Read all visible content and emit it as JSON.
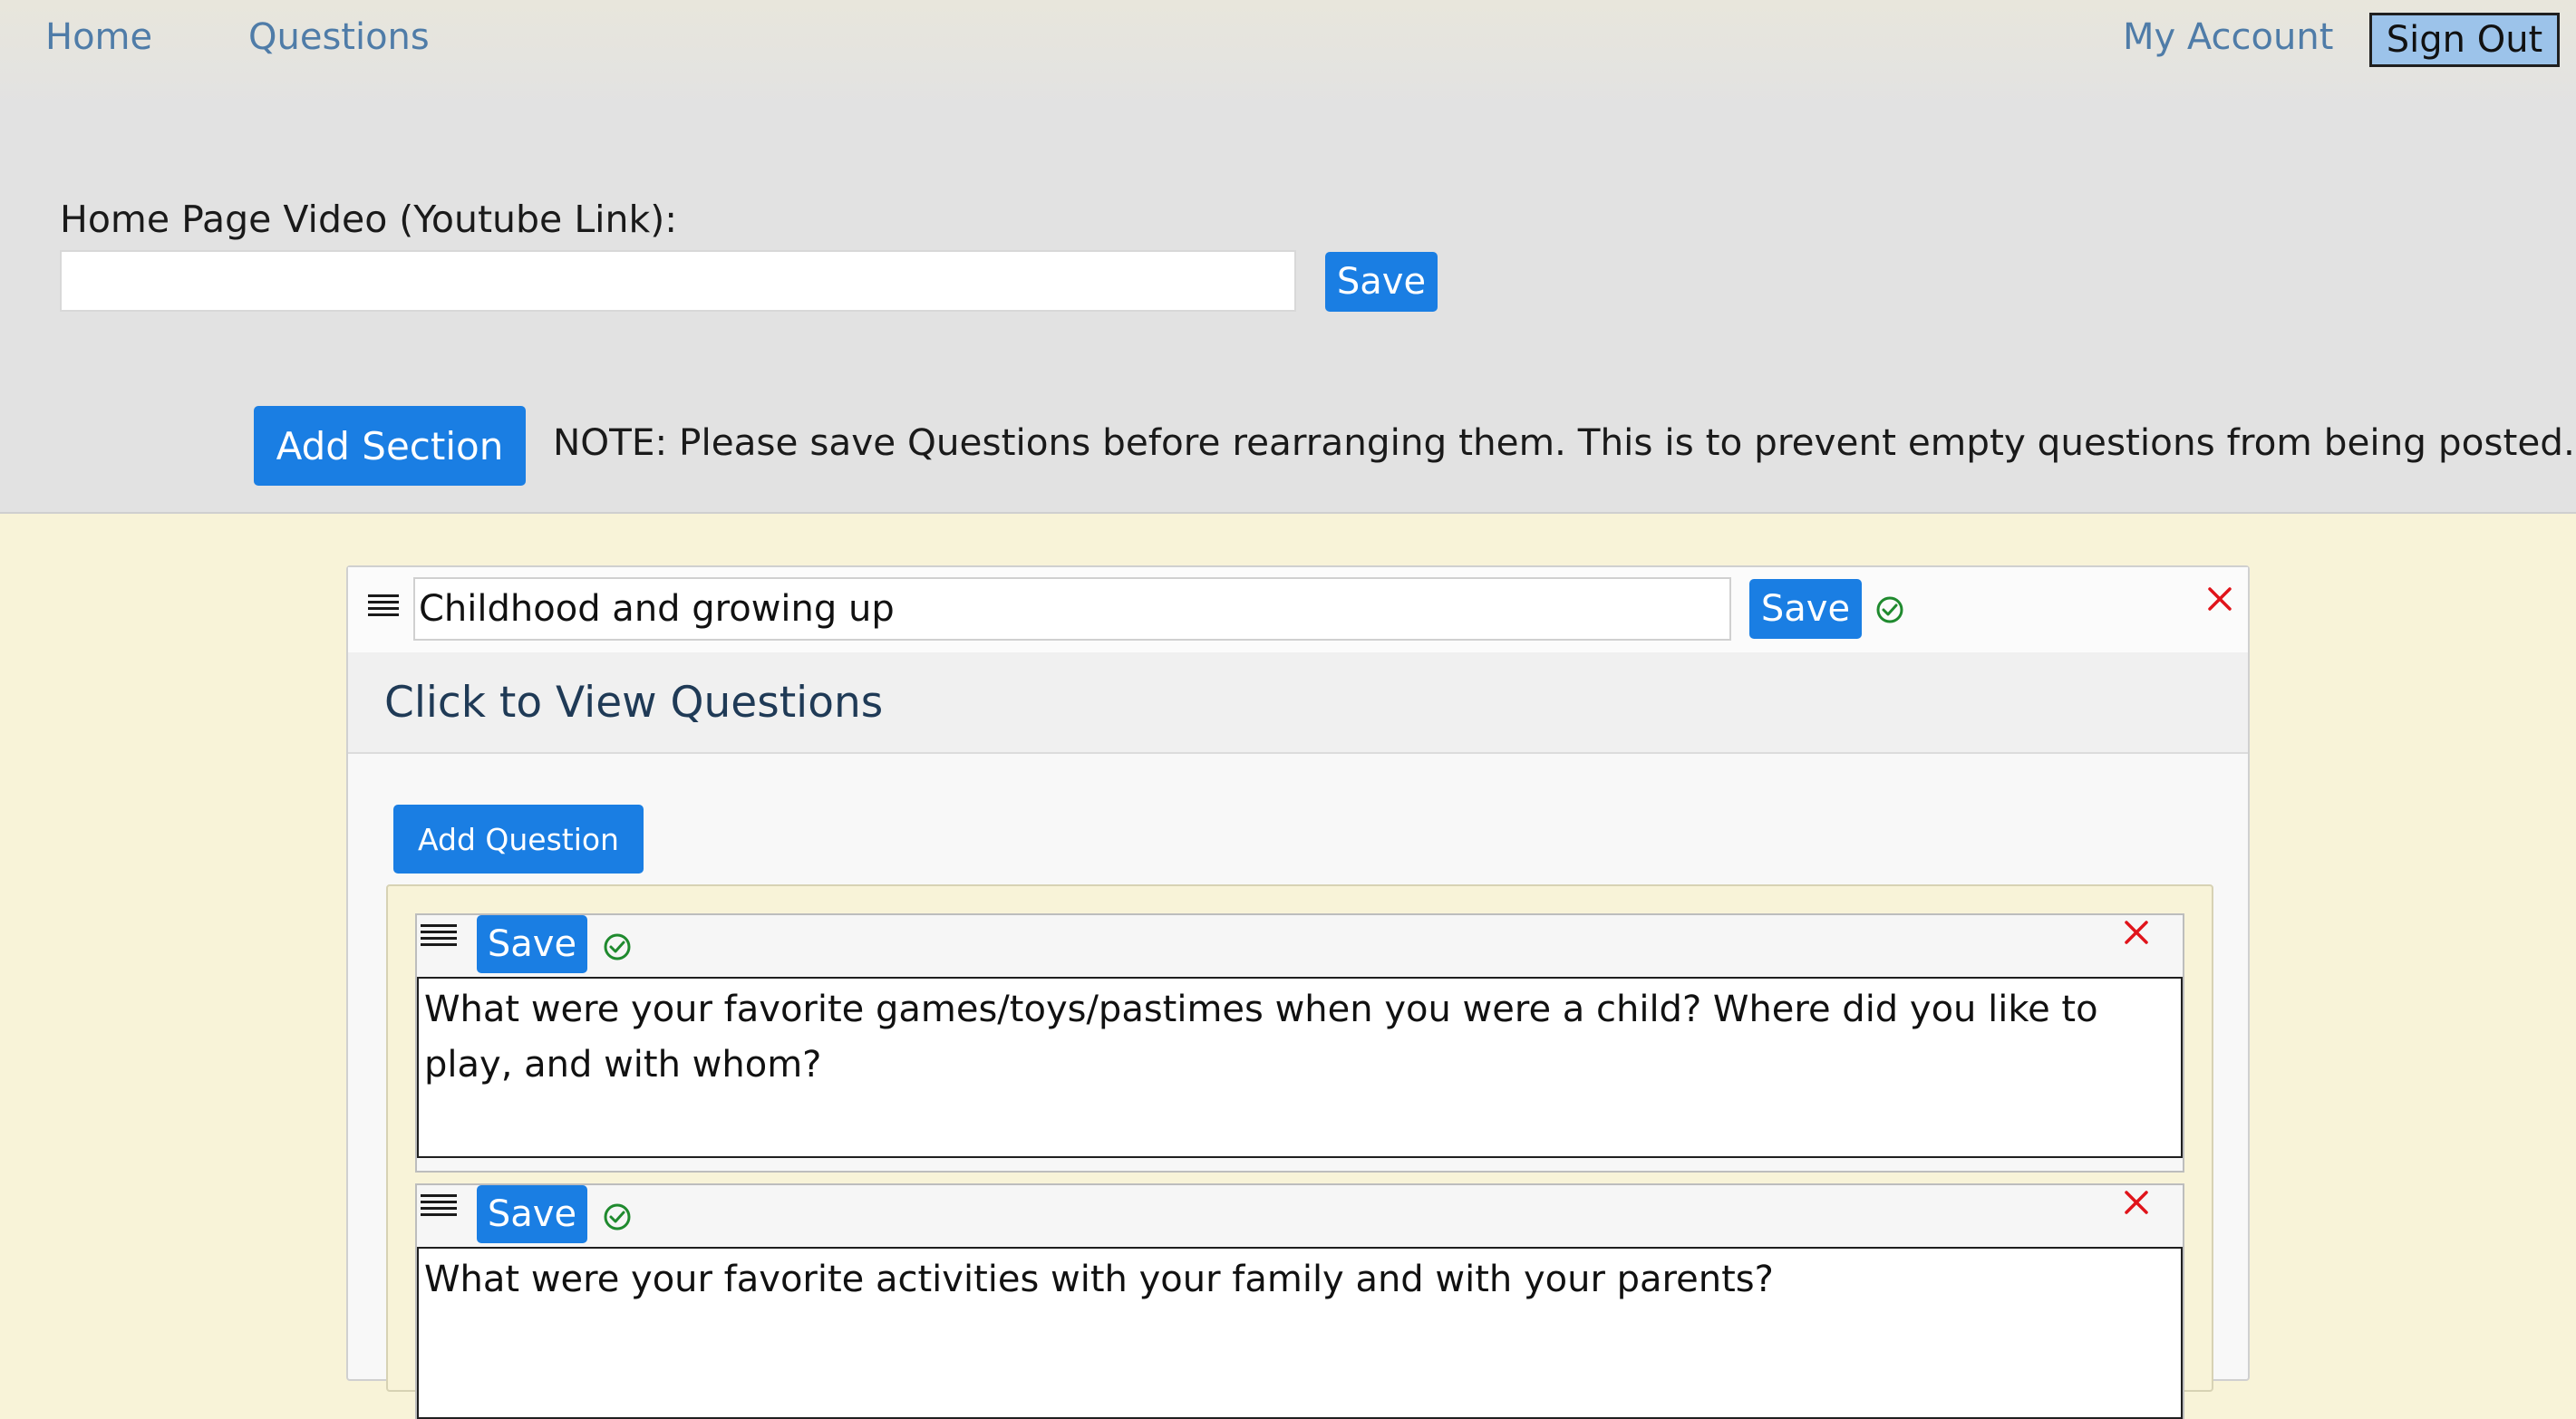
{
  "nav": {
    "home": "Home",
    "questions": "Questions",
    "my_account": "My Account",
    "sign_out": "Sign Out"
  },
  "video": {
    "label": "Home Page Video (Youtube Link):",
    "value": "",
    "placeholder": "",
    "save_label": "Save"
  },
  "actions": {
    "add_section": "Add Section",
    "note": "NOTE: Please save Questions before rearranging them. This is to prevent empty questions from being posted."
  },
  "section": {
    "title": "Childhood and growing up",
    "save_label": "Save",
    "view_questions": "Click to View Questions",
    "add_question": "Add Question",
    "questions": [
      {
        "save_label": "Save",
        "text": "What were your favorite games/toys/pastimes when you were a child? Where did you like to play, and with whom?"
      },
      {
        "save_label": "Save",
        "text": "What were your favorite activities with your family and with your parents?"
      }
    ]
  },
  "colors": {
    "accent": "#1a7ee3",
    "nav_link": "#4f7ca8",
    "sign_out_bg": "#9cc3ea",
    "page_bg": "#f8f3d8",
    "top_bg": "#e2e2e2",
    "saved_check": "#1f8a2e",
    "delete": "#e0141b"
  },
  "icons": {
    "drag": "drag-handle-icon",
    "saved": "check-circle-icon",
    "delete": "close-icon"
  }
}
